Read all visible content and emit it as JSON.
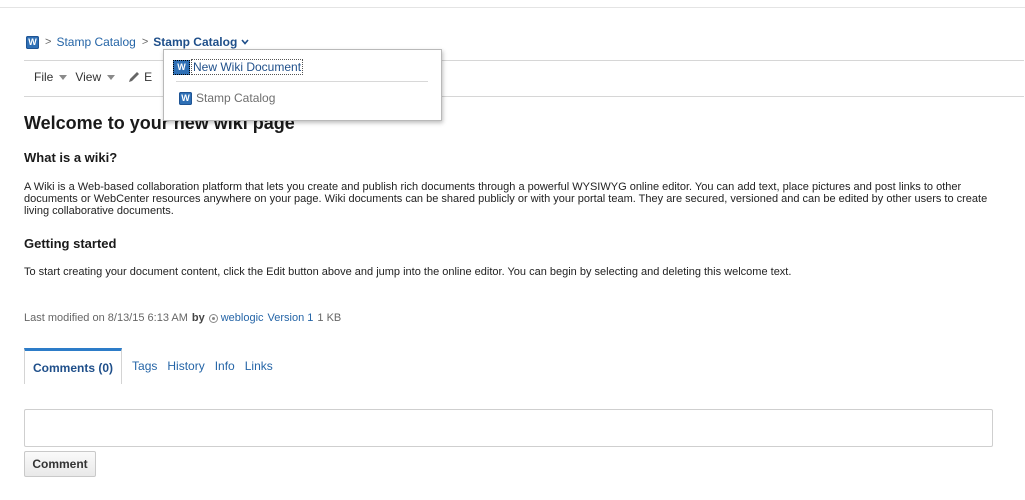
{
  "breadcrumb": {
    "items": [
      "Stamp Catalog"
    ],
    "current": "Stamp Catalog",
    "separator": ">",
    "logo_letter": "W"
  },
  "toolbar": {
    "file_label": "File",
    "view_label": "View",
    "edit_truncated": "E"
  },
  "dropdown": {
    "items": [
      {
        "label": "New Wiki Document",
        "icon": "new-wiki-document-icon",
        "icon_letter": "W"
      },
      {
        "label": "Stamp Catalog",
        "icon": "wiki-icon",
        "icon_letter": "W"
      }
    ]
  },
  "content": {
    "title": "Welcome to your new wiki page",
    "section1_heading": "What is a wiki?",
    "section1_text": "A Wiki is a Web-based collaboration platform that lets you create and publish rich documents through a powerful WYSIWYG online editor. You can add text, place pictures and post links to other documents or WebCenter resources anywhere on your page. Wiki documents can be shared publicly or with your portal team. They are secured, versioned and can be edited by other users to create living collaborative documents.",
    "section2_heading": "Getting started",
    "section2_text": "To start creating your document content, click the Edit button above and jump into the online editor. You can begin by selecting and deleting this welcome text."
  },
  "meta": {
    "modified_prefix": "Last modified on 8/13/15 6:13 AM",
    "by_label": "by",
    "user": "weblogic",
    "version": "Version 1",
    "size": "1 KB"
  },
  "tabs": {
    "active": "Comments (0)",
    "others": [
      "Tags",
      "History",
      "Info",
      "Links"
    ]
  },
  "comment": {
    "input_value": "",
    "button_label": "Comment"
  },
  "colors": {
    "link": "#2565a7",
    "active_tab_border": "#2d7cc8",
    "logo_blue": "#2e6fb5"
  }
}
